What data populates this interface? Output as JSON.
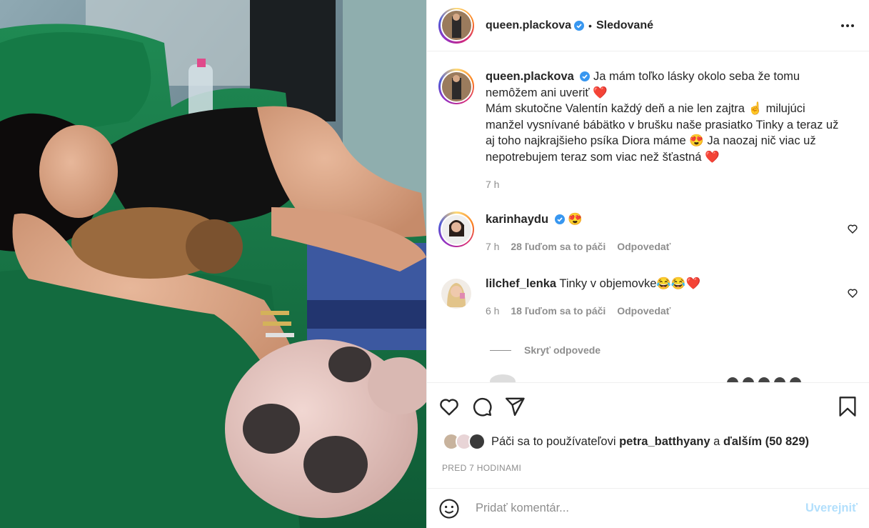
{
  "post": {
    "photo_alt": "woman with dog and pig on green sofa"
  },
  "header": {
    "username": "queen.plackova",
    "separator": "•",
    "follow_state": "Sledované"
  },
  "caption": {
    "username": "queen.plackova",
    "text_line1": "Ja mám toľko lásky okolo seba že tomu",
    "text_line2": "nemôžem ani uveriť ❤️",
    "text_line3": "Mám skutočne Valentín každý deň a nie len zajtra ☝️ milujúci",
    "text_line4": "manžel vysnívané bábätko v brušku naše prasiatko Tinky a teraz už",
    "text_line5": "aj toho najkrajšieho psíka Diora máme 😍 Ja naozaj nič viac už",
    "text_line6": "nepotrebujem teraz som viac než šťastná ❤️",
    "time": "7 h"
  },
  "comments": [
    {
      "username": "karinhaydu",
      "text": "😍",
      "time": "7 h",
      "likes": "28 ľuďom sa to páči",
      "reply": "Odpovedať"
    },
    {
      "username": "lilchef_lenka",
      "text": "Tinky v objemovke😂😂❤️",
      "time": "6 h",
      "likes": "18 ľuďom sa to páči",
      "reply": "Odpovedať"
    }
  ],
  "hide_replies": "Skryť odpovede",
  "likes": {
    "prefix": "Páči sa to používateľovi",
    "user": "petra_batthyany",
    "connector": "a",
    "others": "ďalším (50 829)"
  },
  "posted": "PRED 7 HODINAMI",
  "add_comment": {
    "placeholder": "Pridať komentár...",
    "publish": "Uverejniť"
  },
  "colors": {
    "verified": "#3897f0",
    "heart": "#ed4956",
    "muted": "#8e8e8e",
    "publish_disabled": "#b2dffc",
    "sofa_green": "#1f7a4c"
  }
}
